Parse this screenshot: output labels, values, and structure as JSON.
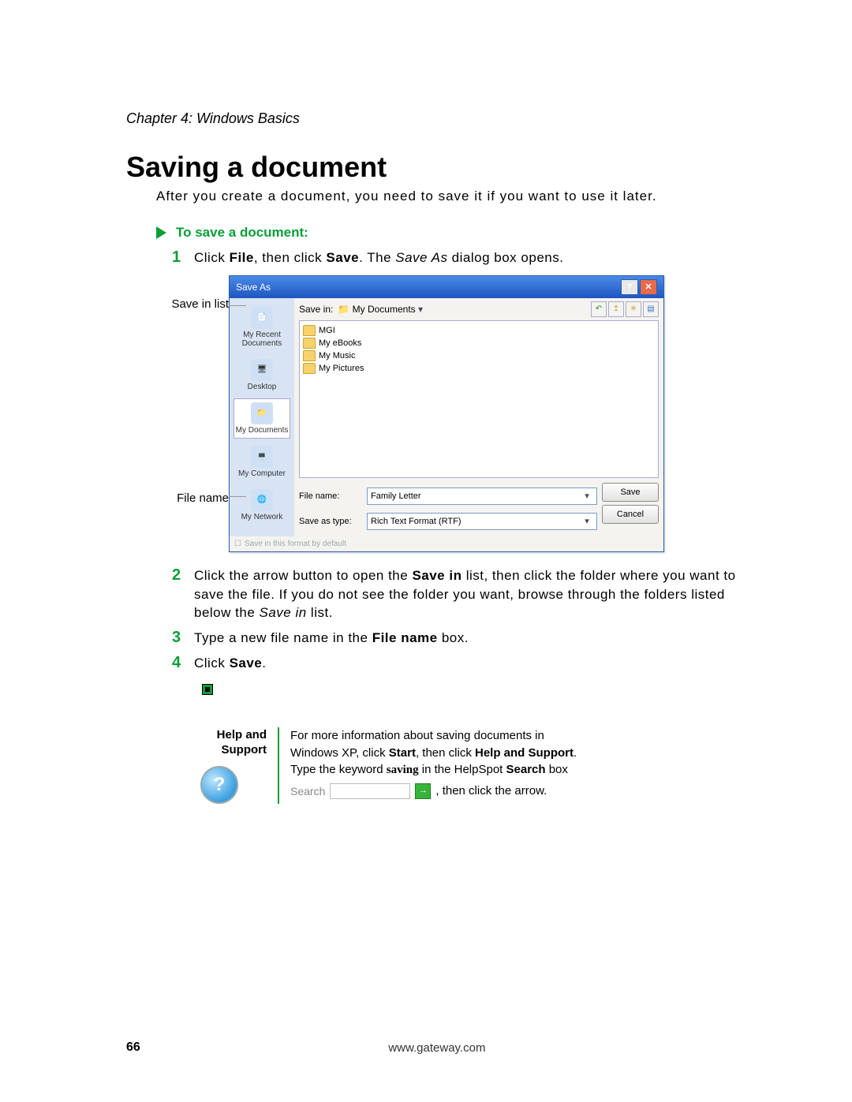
{
  "chapter": "Chapter 4: Windows Basics",
  "title": "Saving a document",
  "intro": "After you create a document, you need to save it if you want to use it later.",
  "section_label": "To save a document:",
  "steps": {
    "s1": {
      "num": "1",
      "pre": "Click ",
      "b1": "File",
      "mid": ", then click ",
      "b2": "Save",
      "post": ". The ",
      "i1": "Save As",
      "tail": " dialog box opens."
    },
    "s2": {
      "num": "2",
      "pre": "Click the arrow button to open the ",
      "b1": "Save in",
      "mid": " list, then click the folder where you want to save the file. If you do not see the folder you want, browse through the folders listed below the ",
      "i1": "Save in",
      "tail": " list."
    },
    "s3": {
      "num": "3",
      "pre": "Type a new file name in the ",
      "b1": "File name",
      "tail": " box."
    },
    "s4": {
      "num": "4",
      "pre": "Click ",
      "b1": "Save",
      "tail": "."
    }
  },
  "callouts": {
    "save_in": "Save in list",
    "file_name": "File name"
  },
  "save_as": {
    "title": "Save As",
    "savein_label": "Save in:",
    "savein_value": "My Documents",
    "places": {
      "recent": "My Recent Documents",
      "desktop": "Desktop",
      "mydocs": "My Documents",
      "mycomp": "My Computer",
      "mynet": "My Network"
    },
    "items": [
      "MGI",
      "My eBooks",
      "My Music",
      "My Pictures"
    ],
    "filename_label": "File name:",
    "filename_value": "Family Letter",
    "type_label": "Save as type:",
    "type_value": "Rich Text Format (RTF)",
    "btn_save": "Save",
    "btn_cancel": "Cancel",
    "note": "Save in this format by default"
  },
  "help": {
    "heading1": "Help and",
    "heading2": "Support",
    "line1a": "For more information about saving documents in",
    "line1b": "Windows XP, click ",
    "b1": "Start",
    "line1c": ", then click ",
    "b2": "Help and Support",
    "line1d": ".",
    "line2a": "Type the keyword ",
    "kw": "saving",
    "line2b": " in the HelpSpot ",
    "b3": "Search",
    "line2c": " box",
    "search_label": "Search",
    "line3": ", then click the arrow."
  },
  "footer": {
    "page": "66",
    "url": "www.gateway.com"
  }
}
